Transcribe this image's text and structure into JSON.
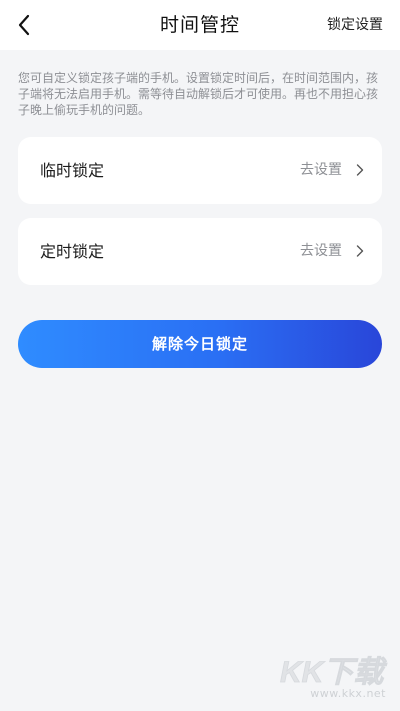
{
  "header": {
    "title": "时间管控",
    "action_label": "锁定设置",
    "back_icon": "chevron-left-icon"
  },
  "description": "您可自定义锁定孩子端的手机。设置锁定时间后，在时间范围内，孩子端将无法启用手机。需等待自动解锁后才可使用。再也不用担心孩子晚上偷玩手机的问题。",
  "settings": [
    {
      "label": "临时锁定",
      "action": "去设置",
      "icon": "chevron-right-icon"
    },
    {
      "label": "定时锁定",
      "action": "去设置",
      "icon": "chevron-right-icon"
    }
  ],
  "primary_button": {
    "label": "解除今日锁定",
    "gradient_start": "#2f8cff",
    "gradient_end": "#2946d9"
  },
  "watermark": {
    "logo": "KK下载",
    "url": "www.kkx.net"
  },
  "colors": {
    "background": "#f4f5f7",
    "card": "#ffffff",
    "muted_text": "#8d8f94"
  }
}
